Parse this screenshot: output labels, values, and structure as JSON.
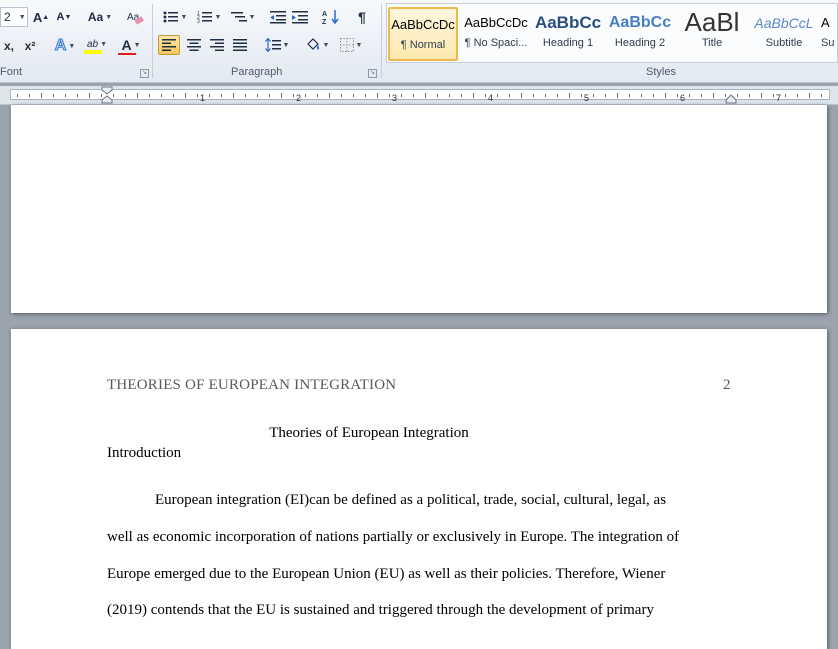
{
  "ribbon": {
    "font_size_partial": "2",
    "font_group_label": "Font",
    "paragraph_group_label": "Paragraph",
    "styles_group_label": "Styles",
    "font_buttons": {
      "grow": "A",
      "shrink": "A",
      "change_case": "Aa",
      "subscript": "x,",
      "superscript": "x²",
      "text_effects": "A",
      "highlight": "ab",
      "font_color": "A"
    },
    "paragraph_buttons": {
      "show_marks": "¶",
      "sort": "A↓Z"
    },
    "styles": [
      {
        "preview": "AaBbCcDc",
        "name": "¶ Normal",
        "selected": true
      },
      {
        "preview": "AaBbCcDc",
        "name": "¶ No Spaci...",
        "selected": false
      },
      {
        "preview": "AaBbCc",
        "name": "Heading 1",
        "selected": false
      },
      {
        "preview": "AaBbCc",
        "name": "Heading 2",
        "selected": false
      },
      {
        "preview": "AaBl",
        "name": "Title",
        "selected": false
      },
      {
        "preview": "AaBbCcL",
        "name": "Subtitle",
        "selected": false
      },
      {
        "preview": "A",
        "name": "Su",
        "selected": false
      }
    ],
    "colors": {
      "highlight": "#ffff00",
      "font_color": "#e02020"
    }
  },
  "ruler": {
    "numbers": [
      "1",
      "2",
      "3",
      "4",
      "5",
      "6",
      "7"
    ]
  },
  "document": {
    "running_head": "THEORIES OF EUROPEAN INTEGRATION",
    "page_number": "2",
    "title": "Theories of European Integration",
    "section_heading": "Introduction",
    "lines": [
      "European integration (EI)can be defined as a political, trade, social, cultural, legal, as",
      "well as economic incorporation of nations partially or exclusively in Europe. The integration of",
      "Europe emerged due to the European Union (EU) as well as their policies. Therefore, Wiener",
      "(2019) contends that the EU is sustained and triggered through the development of primary"
    ]
  }
}
